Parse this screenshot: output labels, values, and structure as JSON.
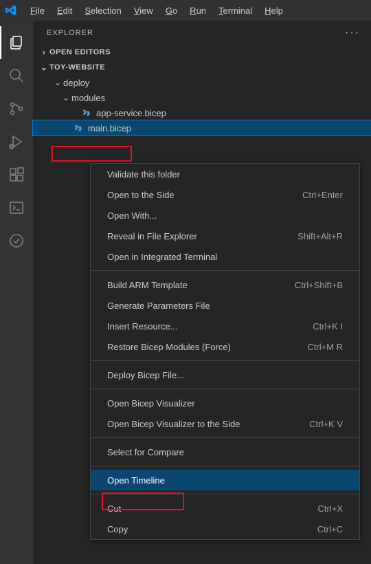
{
  "menubar": {
    "file": "File",
    "edit": "Edit",
    "selection": "Selection",
    "view": "View",
    "go": "Go",
    "run": "Run",
    "terminal": "Terminal",
    "help": "Help"
  },
  "sidebar": {
    "title": "EXPLORER",
    "open_editors": "OPEN EDITORS",
    "workspace": "TOY-WEBSITE",
    "tree": {
      "deploy": "deploy",
      "modules": "modules",
      "app_service": "app-service.bicep",
      "main": "main.bicep"
    }
  },
  "context_menu": {
    "validate": "Validate this folder",
    "open_side": "Open to the Side",
    "open_side_key": "Ctrl+Enter",
    "open_with": "Open With...",
    "reveal": "Reveal in File Explorer",
    "reveal_key": "Shift+Alt+R",
    "integrated_terminal": "Open in Integrated Terminal",
    "build_arm": "Build ARM Template",
    "build_arm_key": "Ctrl+Shift+B",
    "gen_params": "Generate Parameters File",
    "insert_resource": "Insert Resource...",
    "insert_resource_key": "Ctrl+K I",
    "restore_bicep": "Restore Bicep Modules (Force)",
    "restore_bicep_key": "Ctrl+M R",
    "deploy_bicep": "Deploy Bicep File...",
    "open_visualizer": "Open Bicep Visualizer",
    "open_visualizer_side": "Open Bicep Visualizer to the Side",
    "open_visualizer_side_key": "Ctrl+K V",
    "select_compare": "Select for Compare",
    "open_timeline": "Open Timeline",
    "cut": "Cut",
    "cut_key": "Ctrl+X",
    "copy": "Copy",
    "copy_key": "Ctrl+C"
  }
}
